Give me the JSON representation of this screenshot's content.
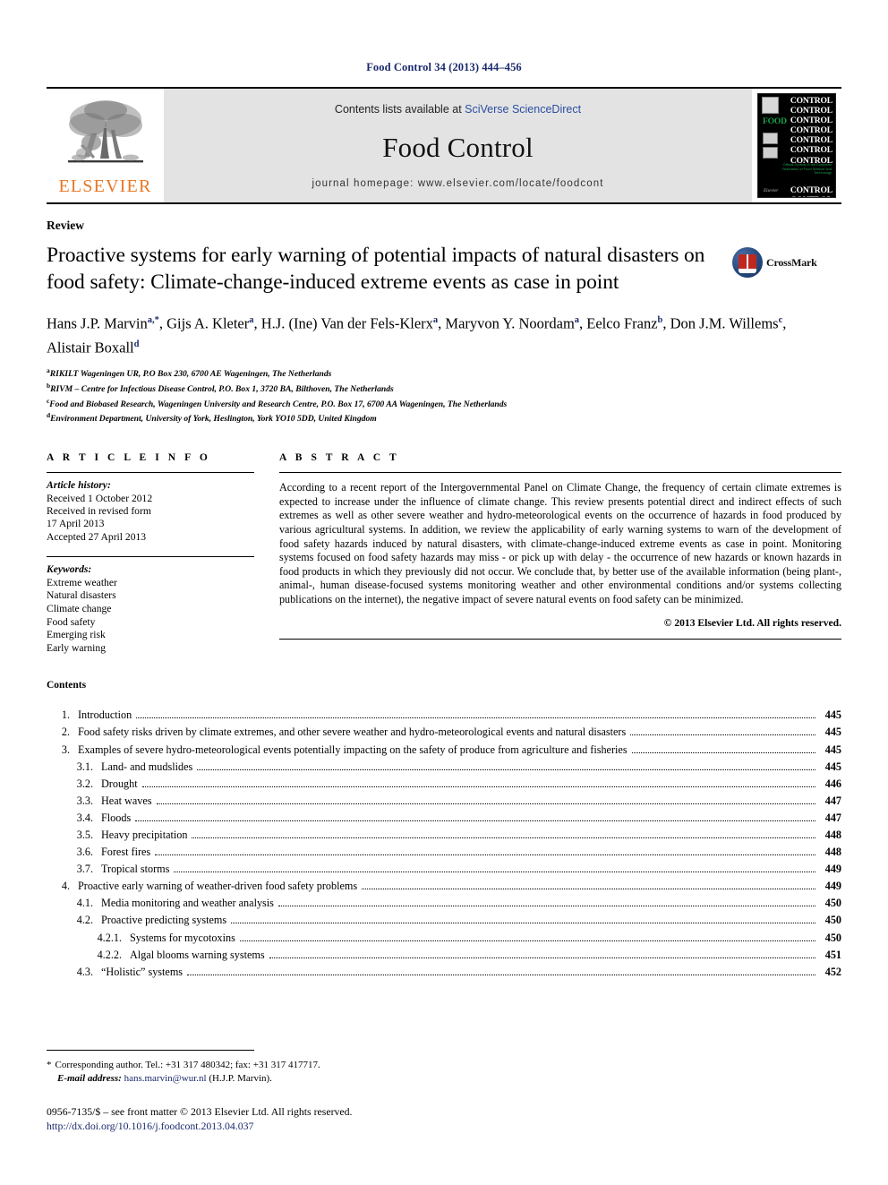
{
  "running_head": "Food Control 34 (2013) 444–456",
  "masthead": {
    "elsevier_wordmark": "ELSEVIER",
    "contents_prefix": "Contents lists available at ",
    "sciencedirect_link": "SciVerse ScienceDirect",
    "journal_name": "Food Control",
    "homepage": "journal homepage: www.elsevier.com/locate/foodcont",
    "cover": {
      "repeat_word": "CONTROL",
      "food_word": "FOOD",
      "tagline": "Official Journal of the European Federation of Food Science and Technology",
      "brand": "Elsevier"
    }
  },
  "article": {
    "type": "Review",
    "title": "Proactive systems for early warning of potential impacts of natural disasters on food safety: Climate-change-induced extreme events as case in point",
    "crossmark_label": "CrossMark",
    "authors_line1": "Hans J.P. Marvin",
    "authors": [
      {
        "name": "Hans J.P. Marvin",
        "sup": "a,*"
      },
      {
        "name": "Gijs A. Kleter",
        "sup": "a"
      },
      {
        "name": "H.J. (Ine) Van der Fels-Klerx",
        "sup": "a"
      },
      {
        "name": "Maryvon Y. Noordam",
        "sup": "a"
      },
      {
        "name": "Eelco Franz",
        "sup": "b"
      },
      {
        "name": "Don J.M. Willems",
        "sup": "c"
      },
      {
        "name": "Alistair Boxall",
        "sup": "d"
      }
    ],
    "affiliations": [
      {
        "mark": "a",
        "text": "RIKILT Wageningen UR, P.O Box 230, 6700 AE Wageningen, The Netherlands"
      },
      {
        "mark": "b",
        "text": "RIVM – Centre for Infectious Disease Control, P.O. Box 1, 3720 BA, Bilthoven, The Netherlands"
      },
      {
        "mark": "c",
        "text": "Food and Biobased Research, Wageningen University and Research Centre, P.O. Box 17, 6700 AA Wageningen, The Netherlands"
      },
      {
        "mark": "d",
        "text": "Environment Department, University of York, Heslington, York YO10 5DD, United Kingdom"
      }
    ]
  },
  "article_info": {
    "heading": "A R T I C L E   I N F O",
    "history_label": "Article history:",
    "history": [
      "Received 1 October 2012",
      "Received in revised form",
      "17 April 2013",
      "Accepted 27 April 2013"
    ],
    "keywords_label": "Keywords:",
    "keywords": [
      "Extreme weather",
      "Natural disasters",
      "Climate change",
      "Food safety",
      "Emerging risk",
      "Early warning"
    ]
  },
  "abstract": {
    "heading": "A B S T R A C T",
    "text": "According to a recent report of the Intergovernmental Panel on Climate Change, the frequency of certain climate extremes is expected to increase under the influence of climate change. This review presents potential direct and indirect effects of such extremes as well as other severe weather and hydro-meteorological events on the occurrence of hazards in food produced by various agricultural systems. In addition, we review the applicability of early warning systems to warn of the development of food safety hazards induced by natural disasters, with climate-change-induced extreme events as case in point. Monitoring systems focused on food safety hazards may miss - or pick up with delay - the occurrence of new hazards or known hazards in food products in which they previously did not occur. We conclude that, by better use of the available information (being plant-, animal-, human disease-focused systems monitoring weather and other environmental conditions and/or systems collecting publications on the internet), the negative impact of severe natural events on food safety can be minimized.",
    "copyright": "© 2013 Elsevier Ltd. All rights reserved."
  },
  "contents": {
    "heading": "Contents",
    "entries": [
      {
        "num": "1.",
        "level": 1,
        "label": "Introduction",
        "page": "445"
      },
      {
        "num": "2.",
        "level": 1,
        "label": "Food safety risks driven by climate extremes, and other severe weather and hydro-meteorological events and natural disasters",
        "page": "445"
      },
      {
        "num": "3.",
        "level": 1,
        "label": "Examples of severe hydro-meteorological events potentially impacting on the safety of produce from agriculture and fisheries",
        "page": "445"
      },
      {
        "num": "3.1.",
        "level": 2,
        "label": "Land- and mudslides",
        "page": "445"
      },
      {
        "num": "3.2.",
        "level": 2,
        "label": "Drought",
        "page": "446"
      },
      {
        "num": "3.3.",
        "level": 2,
        "label": "Heat waves",
        "page": "447"
      },
      {
        "num": "3.4.",
        "level": 2,
        "label": "Floods",
        "page": "447"
      },
      {
        "num": "3.5.",
        "level": 2,
        "label": "Heavy precipitation",
        "page": "448"
      },
      {
        "num": "3.6.",
        "level": 2,
        "label": "Forest fires",
        "page": "448"
      },
      {
        "num": "3.7.",
        "level": 2,
        "label": "Tropical storms",
        "page": "449"
      },
      {
        "num": "4.",
        "level": 1,
        "label": "Proactive early warning of weather-driven food safety problems",
        "page": "449"
      },
      {
        "num": "4.1.",
        "level": 2,
        "label": "Media monitoring and weather analysis",
        "page": "450"
      },
      {
        "num": "4.2.",
        "level": 2,
        "label": "Proactive predicting systems",
        "page": "450"
      },
      {
        "num": "4.2.1.",
        "level": 3,
        "label": "Systems for mycotoxins",
        "page": "450"
      },
      {
        "num": "4.2.2.",
        "level": 3,
        "label": "Algal blooms warning systems",
        "page": "451"
      },
      {
        "num": "4.3.",
        "level": 2,
        "label": "“Holistic” systems",
        "page": "452"
      }
    ]
  },
  "footnote": {
    "corresponding": "Corresponding author. Tel.: +31 317 480342; fax: +31 317 417717.",
    "email_label": "E-mail address:",
    "email": "hans.marvin@wur.nl",
    "email_owner": "(H.J.P. Marvin)."
  },
  "footer": {
    "issn_line": "0956-7135/$ – see front matter © 2013 Elsevier Ltd. All rights reserved.",
    "doi": "http://dx.doi.org/10.1016/j.foodcont.2013.04.037"
  }
}
